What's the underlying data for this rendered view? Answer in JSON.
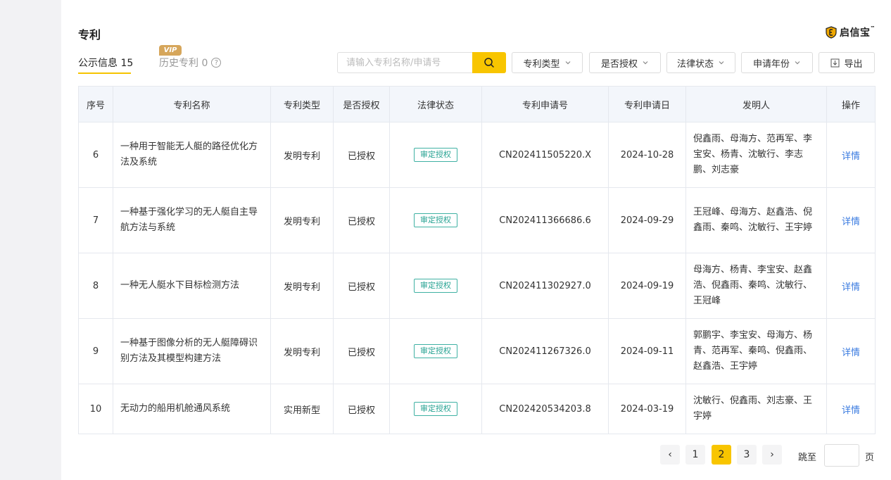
{
  "header": {
    "title": "专利",
    "brand": "启信宝",
    "brand_mark": "™"
  },
  "tabs": {
    "public_label": "公示信息",
    "public_count": "15",
    "history_label": "历史专利",
    "history_count": "0",
    "vip_badge": "VIP",
    "help_icon": "?"
  },
  "search": {
    "placeholder": "请输入专利名称/申请号"
  },
  "filters": {
    "patent_type": "专利类型",
    "granted": "是否授权",
    "legal_status": "法律状态",
    "apply_year": "申请年份",
    "export": "导出"
  },
  "table": {
    "headers": [
      "序号",
      "专利名称",
      "专利类型",
      "是否授权",
      "法律状态",
      "专利申请号",
      "专利申请日",
      "发明人",
      "操作"
    ],
    "rows": [
      {
        "no": "6",
        "name": "一种用于智能无人艇的路径优化方法及系统",
        "type": "发明专利",
        "granted": "已授权",
        "status": "审定授权",
        "app_no": "CN202411505220.X",
        "date": "2024-10-28",
        "inventors": "倪鑫雨、母海方、范再军、李宝安、杨青、沈敏行、李志鹏、刘志豪",
        "action": "详情"
      },
      {
        "no": "7",
        "name": "一种基于强化学习的无人艇自主导航方法与系统",
        "type": "发明专利",
        "granted": "已授权",
        "status": "审定授权",
        "app_no": "CN202411366686.6",
        "date": "2024-09-29",
        "inventors": "王冠峰、母海方、赵鑫浩、倪鑫雨、秦鸣、沈敏行、王宇婷",
        "action": "详情"
      },
      {
        "no": "8",
        "name": "一种无人艇水下目标检测方法",
        "type": "发明专利",
        "granted": "已授权",
        "status": "审定授权",
        "app_no": "CN202411302927.0",
        "date": "2024-09-19",
        "inventors": "母海方、杨青、李宝安、赵鑫浩、倪鑫雨、秦鸣、沈敏行、王冠峰",
        "action": "详情"
      },
      {
        "no": "9",
        "name": "一种基于图像分析的无人艇障碍识别方法及其模型构建方法",
        "type": "发明专利",
        "granted": "已授权",
        "status": "审定授权",
        "app_no": "CN202411267326.0",
        "date": "2024-09-11",
        "inventors": "郭鹏宇、李宝安、母海方、杨青、范再军、秦鸣、倪鑫雨、赵鑫浩、王宇婷",
        "action": "详情"
      },
      {
        "no": "10",
        "name": "无动力的船用机舱通风系统",
        "type": "实用新型",
        "granted": "已授权",
        "status": "审定授权",
        "app_no": "CN202420534203.8",
        "date": "2024-03-19",
        "inventors": "沈敏行、倪鑫雨、刘志豪、王宇婷",
        "action": "详情"
      }
    ]
  },
  "pagination": {
    "prev": "‹",
    "next": "›",
    "pages": [
      "1",
      "2",
      "3"
    ],
    "current_page": "2",
    "jump_label": "跳至",
    "page_unit": "页"
  },
  "colors": {
    "accent": "#f8c500",
    "link": "#3a7be0",
    "tag": "#27a393",
    "vip": "#d6a65b"
  },
  "icons": {
    "search": "search-icon",
    "chevron": "chevron-down-icon",
    "export": "download-icon",
    "help": "help-circle-icon",
    "brand": "brand-shield-icon"
  }
}
